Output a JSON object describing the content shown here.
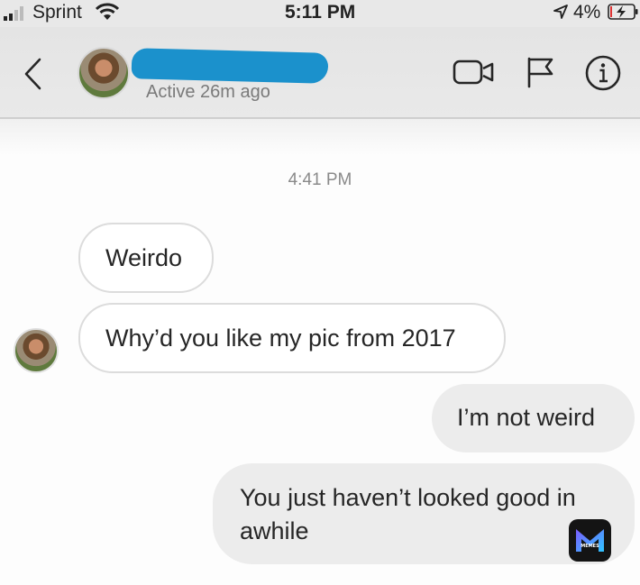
{
  "status_bar": {
    "carrier": "Sprint",
    "time": "5:11 PM",
    "battery_percent": "4%",
    "icons": [
      "signal-icon",
      "wifi-icon",
      "location-arrow-icon",
      "battery-charging-icon"
    ]
  },
  "header": {
    "contact_name": "",
    "presence": "Active 26m ago",
    "icons": [
      "back-chevron-icon",
      "video-call-icon",
      "flag-icon",
      "info-icon"
    ]
  },
  "thread": {
    "timestamp": "4:41 PM",
    "messages": [
      {
        "sender": "them",
        "text": "Weirdo"
      },
      {
        "sender": "them",
        "text": "Why’d you like my pic from 2017"
      },
      {
        "sender": "me",
        "text": "I’m not weird"
      },
      {
        "sender": "me",
        "text": "You just haven’t looked good in awhile"
      }
    ]
  },
  "watermark": {
    "label": "MEMES",
    "icon": "memes-logo-icon"
  },
  "colors": {
    "redaction": "#1b91cc",
    "incoming_bubble": "#ffffff",
    "outgoing_bubble": "#ececec",
    "header_background": "#e6e6e6",
    "secondary_text": "#7a7a7a"
  }
}
